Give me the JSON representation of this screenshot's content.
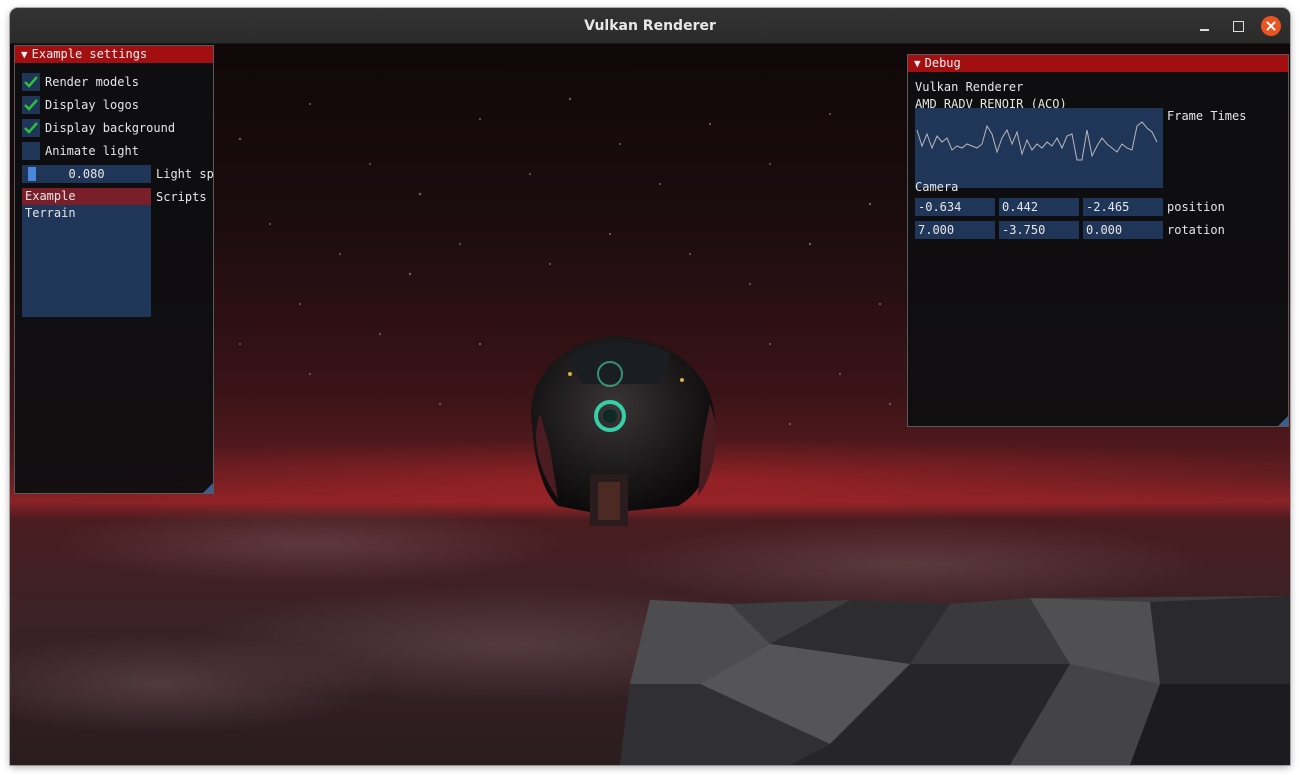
{
  "window": {
    "title": "Vulkan Renderer"
  },
  "settings_panel": {
    "title": "Example settings",
    "checkboxes": [
      {
        "label": "Render models",
        "checked": true
      },
      {
        "label": "Display logos",
        "checked": true
      },
      {
        "label": "Display background",
        "checked": true
      },
      {
        "label": "Animate light",
        "checked": false
      }
    ],
    "slider": {
      "value": "0.080",
      "label": "Light sp",
      "fraction": 0.08
    },
    "list": {
      "label": "Scripts",
      "items": [
        "Example",
        "Terrain"
      ],
      "selected": "Example"
    }
  },
  "debug_panel": {
    "title": "Debug",
    "app_name": "Vulkan Renderer",
    "device": "AMD RADV RENOIR (ACO)",
    "plot_label": "Frame Times",
    "camera_label": "Camera",
    "position": {
      "label": "position",
      "values": [
        "-0.634",
        "0.442",
        "-2.465"
      ]
    },
    "rotation": {
      "label": "rotation",
      "values": [
        "7.000",
        "-3.750",
        "0.000"
      ]
    }
  },
  "colors": {
    "accent_header": "#a30e10",
    "widget_bg": "#1f3659",
    "checkmark": "#2fbf3a",
    "selection": "#7a1e2a",
    "close_button": "#e95420"
  }
}
